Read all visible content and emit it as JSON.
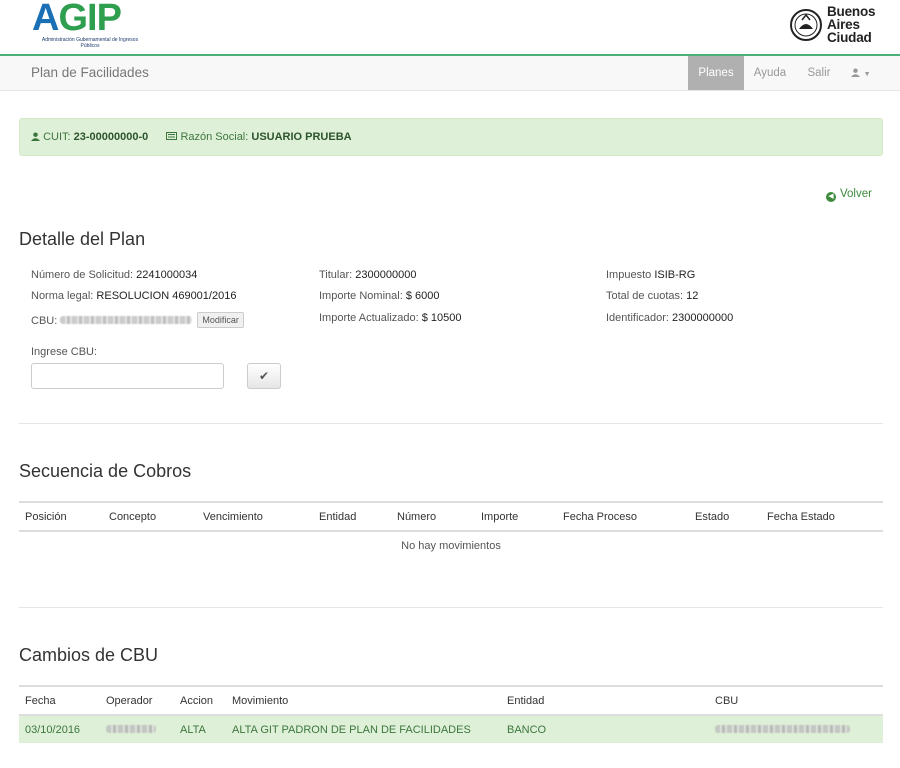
{
  "header": {
    "agip_logo_text": "AGIP",
    "agip_logo_subtitle": "Administración Gubernamental de Ingresos Públicos",
    "ba_logo_lines": [
      "Buenos",
      "Aires",
      "Ciudad"
    ]
  },
  "navbar": {
    "brand": "Plan de Facilidades",
    "items": [
      {
        "label": "Planes",
        "active": true
      },
      {
        "label": "Ayuda",
        "active": false
      },
      {
        "label": "Salir",
        "active": false
      }
    ],
    "user_menu": "user-icon"
  },
  "cuit_bar": {
    "cuit_label": "CUIT:",
    "cuit_value": "23-00000000-0",
    "razon_label": "Razón Social:",
    "razon_value": "USUARIO PRUEBA"
  },
  "volver_label": "Volver",
  "detalle": {
    "title": "Detalle del Plan",
    "numero_solicitud_label": "Número de Solicitud:",
    "numero_solicitud_value": "2241000034",
    "norma_legal_label": "Norma legal:",
    "norma_legal_value": "RESOLUCION 469001/2016",
    "cbu_label": "CBU:",
    "modificar_label": "Modificar",
    "titular_label": "Titular:",
    "titular_value": "2300000000",
    "importe_nominal_label": "Importe Nominal:",
    "importe_nominal_value": "$ 6000",
    "importe_actualizado_label": "Importe Actualizado:",
    "importe_actualizado_value": "$ 10500",
    "impuesto_label": "Impuesto",
    "impuesto_value": "ISIB-RG",
    "total_cuotas_label": "Total de cuotas:",
    "total_cuotas_value": "12",
    "identificador_label": "Identificador:",
    "identificador_value": "2300000000",
    "ingrese_cbu_label": "Ingrese CBU:",
    "ingrese_cbu_value": ""
  },
  "secuencia": {
    "title": "Secuencia de Cobros",
    "columns": [
      "Posición",
      "Concepto",
      "Vencimiento",
      "Entidad",
      "Número",
      "Importe",
      "Fecha Proceso",
      "Estado",
      "Fecha Estado"
    ],
    "empty_message": "No hay movimientos"
  },
  "cambios": {
    "title": "Cambios de CBU",
    "columns": [
      "Fecha",
      "Operador",
      "Accion",
      "Movimiento",
      "Entidad",
      "CBU"
    ],
    "rows": [
      {
        "fecha": "03/10/2016",
        "accion": "ALTA",
        "movimiento": "ALTA GIT PADRON DE PLAN DE FACILIDADES",
        "entidad": "BANCO"
      }
    ]
  },
  "colors": {
    "agip_green": "#2e9e4f",
    "agip_blue": "#1b6fb5",
    "success_bg": "#dff0d8",
    "success_text": "#3c763d",
    "nav_active_bg": "#b0b0b0",
    "accent_rule": "#4bb07a"
  }
}
